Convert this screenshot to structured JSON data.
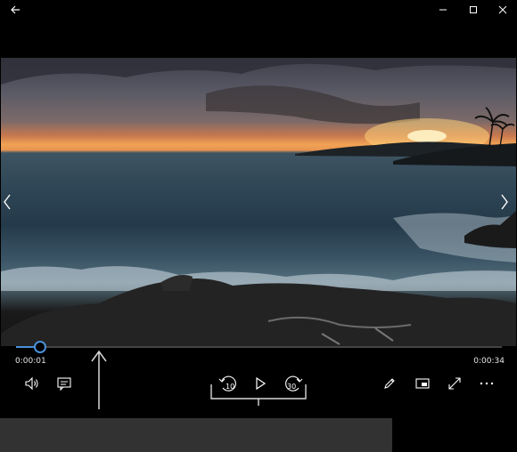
{
  "window": {
    "buttons": [
      "back-arrow",
      "minimize",
      "maximize",
      "close"
    ]
  },
  "player": {
    "current_time": "0:00:01",
    "total_time": "0:00:34",
    "progress": 0.05,
    "skip_back_seconds": "10",
    "skip_forward_seconds": "30"
  },
  "controls": {
    "left": [
      "volume-icon",
      "subtitles-icon"
    ],
    "center": [
      "skip-back-icon",
      "play-icon",
      "skip-forward-icon"
    ],
    "right": [
      "edit-pencil-icon",
      "mini-view-icon",
      "fullscreen-icon",
      "more-icon"
    ]
  },
  "colors": {
    "accent": "#4a90d9",
    "background": "#000000"
  }
}
